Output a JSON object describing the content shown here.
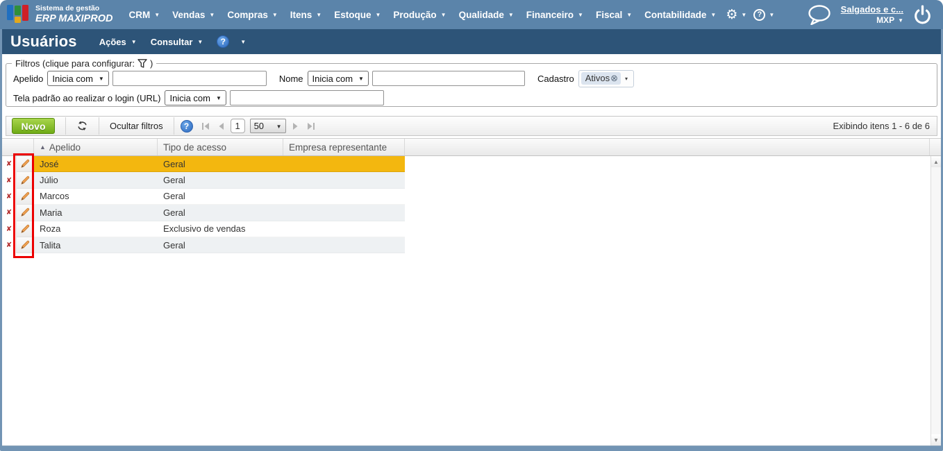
{
  "nav": {
    "brand": {
      "tagline": "Sistema de gestão",
      "name": "ERP MAXIPROD"
    },
    "menus": [
      {
        "label": "CRM"
      },
      {
        "label": "Vendas"
      },
      {
        "label": "Compras"
      },
      {
        "label": "Itens"
      },
      {
        "label": "Estoque"
      },
      {
        "label": "Produção"
      },
      {
        "label": "Qualidade"
      },
      {
        "label": "Financeiro"
      },
      {
        "label": "Fiscal"
      },
      {
        "label": "Contabilidade"
      }
    ],
    "account": {
      "company": "Salgados e c...",
      "workspace": "MXP"
    }
  },
  "titlebar": {
    "title": "Usuários",
    "actions_label": "Ações",
    "consult_label": "Consultar"
  },
  "filters": {
    "legend": "Filtros (clique para configurar:",
    "legend_close": ")",
    "apelido": {
      "label": "Apelido",
      "operator": "Inicia com",
      "value": ""
    },
    "nome": {
      "label": "Nome",
      "operator": "Inicia com",
      "value": ""
    },
    "cadastro": {
      "label": "Cadastro",
      "selected_tag": "Ativos"
    },
    "tela": {
      "label": "Tela padrão ao realizar o login (URL)",
      "operator": "Inicia com",
      "value": ""
    }
  },
  "toolbar": {
    "new_label": "Novo",
    "hide_filters_label": "Ocultar filtros",
    "page": "1",
    "page_size": "50",
    "status": "Exibindo itens 1 - 6 de 6"
  },
  "grid": {
    "columns": [
      "Apelido",
      "Tipo de acesso",
      "Empresa representante"
    ],
    "sorted_column": "Apelido",
    "sort_direction": "asc",
    "selected_index": 0,
    "rows": [
      {
        "apelido": "José",
        "tipo_de_acesso": "Geral",
        "empresa_representante": ""
      },
      {
        "apelido": "Júlio",
        "tipo_de_acesso": "Geral",
        "empresa_representante": ""
      },
      {
        "apelido": "Marcos",
        "tipo_de_acesso": "Geral",
        "empresa_representante": ""
      },
      {
        "apelido": "Maria",
        "tipo_de_acesso": "Geral",
        "empresa_representante": ""
      },
      {
        "apelido": "Roza",
        "tipo_de_acesso": "Exclusivo de vendas",
        "empresa_representante": ""
      },
      {
        "apelido": "Talita",
        "tipo_de_acesso": "Geral",
        "empresa_representante": ""
      }
    ]
  },
  "icons": {
    "dropdown": "▼",
    "dropdown_small": "▾",
    "gear": "⚙",
    "sort_asc": "▲",
    "delete_x": "✘",
    "tag_remove": "⊗",
    "scroll_up": "▲",
    "scroll_down": "▼",
    "help_mark": "?"
  },
  "colors": {
    "nav_bar": "#5b84aa",
    "title_bar": "#2d5478",
    "frame": "#7294b4",
    "selected_row": "#f3b70f",
    "alt_row": "#eef1f3",
    "new_button_green": "#6fab16",
    "annotation_red": "#ec0000",
    "help_blue": "#2e6abf"
  }
}
